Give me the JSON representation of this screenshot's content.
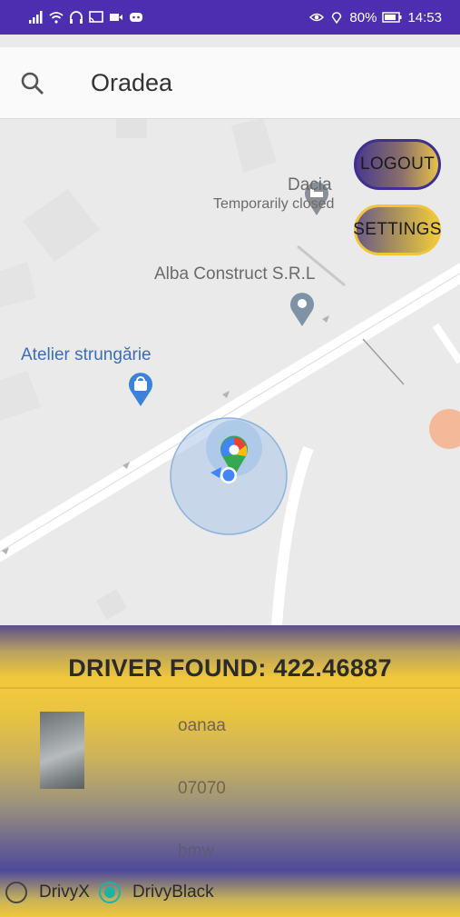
{
  "status_bar": {
    "battery": "80%",
    "time": "14:53"
  },
  "search": {
    "location_text": "Oradea"
  },
  "buttons": {
    "logout": "LOGOUT",
    "settings": "SETTINGS"
  },
  "map": {
    "place_1_name": "Dacia",
    "place_1_status": "Temporarily closed",
    "place_2_name": "Alba Construct S.R.L",
    "place_3_name": "Atelier strungărie"
  },
  "panel": {
    "title": "DRIVER FOUND: 422.46887",
    "driver_name": "oanaa",
    "driver_phone": "07070",
    "driver_car": "bmw",
    "ride_options": [
      {
        "label": "DrivyX",
        "selected": false
      },
      {
        "label": "DrivyBlack",
        "selected": true
      }
    ]
  },
  "colors": {
    "status_bar": "#4b2fb0",
    "accent_gold": "#f0c83a",
    "accent_purple": "#4e4a9a",
    "radio_selected": "#1ab3a6"
  }
}
